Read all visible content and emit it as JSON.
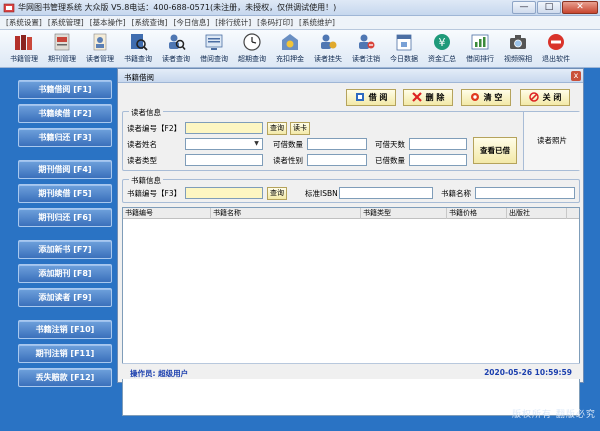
{
  "window": {
    "title": "华网图书管理系统 大众版 V5.8电话：400-688-0571(未注册，未授权，仅供调试使用！)",
    "controls": [
      "—",
      "□",
      "✕"
    ]
  },
  "menu": [
    "[系统设置]",
    "[系统管理]",
    "[基本操作]",
    "[系统查询]",
    "[今日信息]",
    "[排行统计]",
    "[条码打印]",
    "[系统维护]"
  ],
  "toolbar": [
    {
      "label": "书籍管理",
      "icon": "books-icon"
    },
    {
      "label": "期刊管理",
      "icon": "magazine-icon"
    },
    {
      "label": "读者管理",
      "icon": "reader-icon"
    },
    {
      "label": "书籍查询",
      "icon": "book-search-icon"
    },
    {
      "label": "读者查询",
      "icon": "reader-search-icon"
    },
    {
      "label": "借阅查询",
      "icon": "borrow-search-icon"
    },
    {
      "label": "超期查询",
      "icon": "clock-icon"
    },
    {
      "label": "充扣押金",
      "icon": "deposit-icon"
    },
    {
      "label": "读者挂失",
      "icon": "reader-lost-icon"
    },
    {
      "label": "读者注销",
      "icon": "reader-cancel-icon"
    },
    {
      "label": "今日数据",
      "icon": "today-data-icon"
    },
    {
      "label": "资金汇总",
      "icon": "yen-icon"
    },
    {
      "label": "借阅排行",
      "icon": "ranking-icon"
    },
    {
      "label": "视频照相",
      "icon": "camera-icon"
    },
    {
      "label": "退出软件",
      "icon": "exit-icon"
    }
  ],
  "sidebar": [
    "书籍借阅 [F1]",
    "书籍续借 [F2]",
    "书籍归还 [F3]",
    "期刊借阅 [F4]",
    "期刊续借 [F5]",
    "期刊归还 [F6]",
    "添加新书 [F7]",
    "添加期刊 [F8]",
    "添加读者 [F9]",
    "书籍注销 [F10]",
    "期刊注销 [F11]",
    "丢失赔款 [F12]"
  ],
  "dialog": {
    "title": "书籍借阅",
    "close": "x",
    "actions": {
      "borrow": "借 阅",
      "delete": "删 除",
      "clear": "清 空",
      "close": "关 闭"
    },
    "reader_group": "读者信息",
    "reader": {
      "id_label": "读者编号【F2】",
      "query_btn": "查询",
      "card_btn": "读卡",
      "name_label": "读者姓名",
      "type_label": "读者类型",
      "can_borrow_label": "可借数量",
      "gender_label": "读者性别",
      "days_label": "可借天数",
      "borrowed_label": "已借数量",
      "view_borrowed_btn": "查看已借",
      "photo_label": "读者照片"
    },
    "book_group": "书籍信息",
    "book": {
      "id_label": "书籍编号【F3】",
      "query_btn": "查询",
      "isbn_label": "标准ISBN",
      "name_label": "书籍名称"
    },
    "grid_columns": [
      "书籍编号",
      "书籍名称",
      "书籍类型",
      "书籍价格",
      "出版社"
    ],
    "status": {
      "operator": "操作员:  超级用户",
      "datetime": "2020-05-26  10:59:59"
    }
  },
  "footer": "版权所有  翻版必究",
  "colors": {
    "desktop": "#2a73c4",
    "sidebar_btn": "#4a80c8",
    "action_btn": "#f3e9a8",
    "status_text": "#1b3fae"
  }
}
